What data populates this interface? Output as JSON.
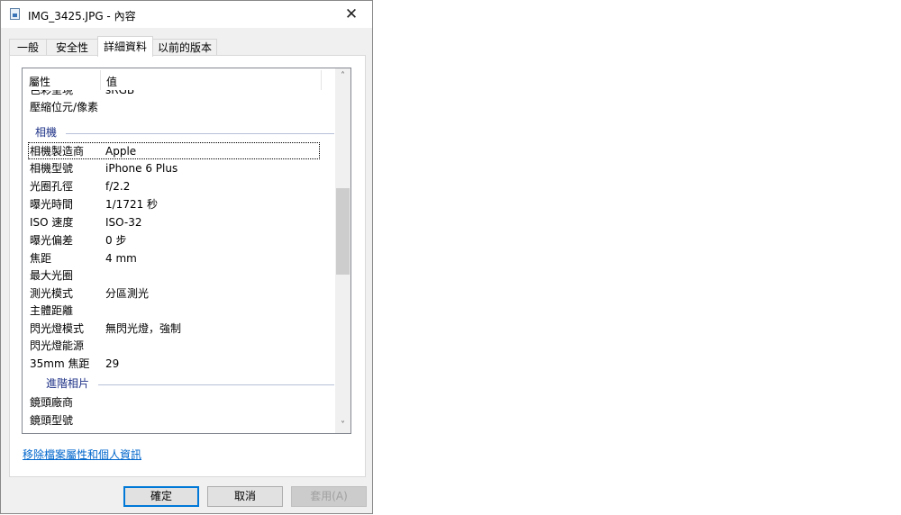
{
  "window": {
    "title": "IMG_3425.JPG - 內容",
    "close_symbol": "✕"
  },
  "tabs": [
    {
      "label": "一般"
    },
    {
      "label": "安全性"
    },
    {
      "label": "詳細資料"
    },
    {
      "label": "以前的版本"
    }
  ],
  "list": {
    "headers": {
      "property": "屬性",
      "value": "值"
    },
    "rows_top": [
      {
        "key": "色彩呈現",
        "value": "sRGB"
      },
      {
        "key": "壓縮位元/像素",
        "value": ""
      }
    ],
    "group_camera": "相機",
    "camera_rows": [
      {
        "key": "相機製造商",
        "value": "Apple"
      },
      {
        "key": "相機型號",
        "value": "iPhone 6 Plus"
      },
      {
        "key": "光圈孔徑",
        "value": "f/2.2"
      },
      {
        "key": "曝光時間",
        "value": "1/1721 秒"
      },
      {
        "key": "ISO 速度",
        "value": "ISO-32"
      },
      {
        "key": "曝光偏差",
        "value": "0 步"
      },
      {
        "key": "焦距",
        "value": "4 mm"
      },
      {
        "key": "最大光圈",
        "value": ""
      },
      {
        "key": "測光模式",
        "value": "分區測光"
      },
      {
        "key": "主體距離",
        "value": ""
      },
      {
        "key": "閃光燈模式",
        "value": "無閃光燈，強制"
      },
      {
        "key": "閃光燈能源",
        "value": ""
      },
      {
        "key": "35mm 焦距",
        "value": "29"
      }
    ],
    "group_advanced": "進階相片",
    "advanced_rows": [
      {
        "key": "鏡頭廠商",
        "value": ""
      },
      {
        "key": "鏡頭型號",
        "value": ""
      }
    ],
    "scroll_up": "˄",
    "scroll_down": "˅"
  },
  "remove_link": "移除檔案屬性和個人資訊",
  "buttons": {
    "ok": "確定",
    "cancel": "取消",
    "apply": "套用(A)"
  }
}
